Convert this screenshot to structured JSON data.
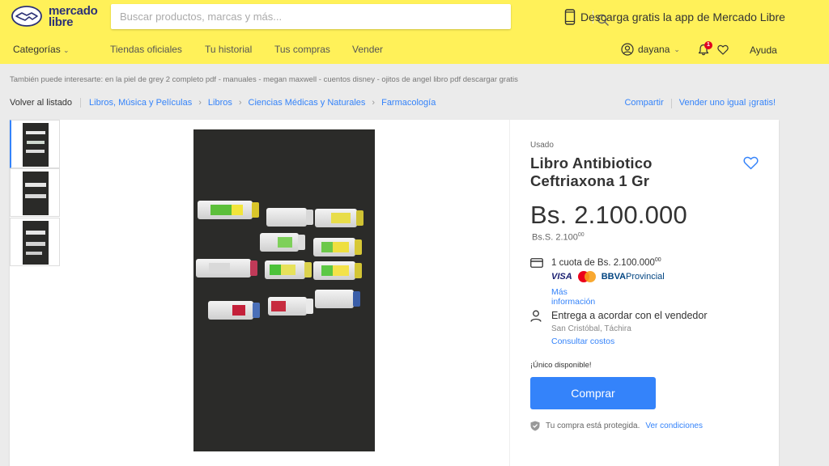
{
  "header": {
    "logo_line1": "mercado",
    "logo_line2": "libre",
    "search_placeholder": "Buscar productos, marcas y más...",
    "app_promo": "Descarga gratis la app de Mercado Libre",
    "brand_color": "#fff159"
  },
  "nav": {
    "categories": "Categorías",
    "items": [
      "Tiendas oficiales",
      "Tu historial",
      "Tus compras",
      "Vender"
    ],
    "username": "dayana",
    "notifications_count": "1",
    "help": "Ayuda"
  },
  "interest_line": "También puede interesarte: en la piel de grey 2 completo pdf - manuales - megan maxwell - cuentos disney - ojitos de angel libro pdf descargar gratis",
  "breadcrumb": {
    "back": "Volver al listado",
    "path": [
      "Libros, Música y Películas",
      "Libros",
      "Ciencias Médicas y Naturales",
      "Farmacología"
    ],
    "share": "Compartir",
    "sell_same": "Vender uno igual ¡gratis!"
  },
  "product": {
    "condition": "Usado",
    "title": "Libro Antibiotico Ceftriaxona 1 Gr",
    "price": "Bs. 2.100.000",
    "price_ss_main": "Bs.S. 2.100",
    "price_ss_cents": "00",
    "installment_main": "1 cuota de Bs. 2.100.000",
    "installment_cents": "00",
    "payment_brands": [
      "VISA",
      "BBVA",
      "Provincial"
    ],
    "more_info": "Más información",
    "delivery": "Entrega a acordar con el vendedor",
    "location": "San Cristóbal, Táchira",
    "shipping_costs": "Consultar costos",
    "stock": "¡Único disponible!",
    "buy_label": "Comprar",
    "protection_text": "Tu compra está protegida.",
    "protection_link": "Ver condiciones",
    "accent_color": "#3483fa"
  }
}
